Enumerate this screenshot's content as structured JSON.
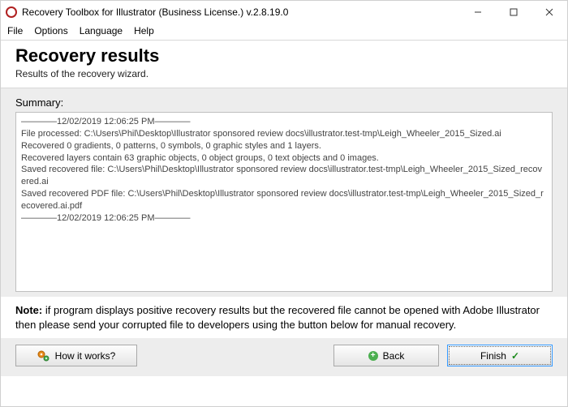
{
  "window": {
    "title": "Recovery Toolbox for Illustrator (Business License.) v.2.8.19.0"
  },
  "menu": {
    "file": "File",
    "options": "Options",
    "language": "Language",
    "help": "Help"
  },
  "heading": {
    "title": "Recovery results",
    "subtitle": "Results of the recovery wizard."
  },
  "summary": {
    "label": "Summary:",
    "text": "————12/02/2019 12:06:25 PM————\nFile processed: C:\\Users\\Phil\\Desktop\\Illustrator sponsored review docs\\illustrator.test-tmp\\Leigh_Wheeler_2015_Sized.ai\nRecovered 0 gradients, 0 patterns, 0 symbols, 0 graphic styles and 1 layers.\nRecovered layers contain 63 graphic objects, 0 object groups, 0 text objects and 0 images.\nSaved recovered file: C:\\Users\\Phil\\Desktop\\Illustrator sponsored review docs\\illustrator.test-tmp\\Leigh_Wheeler_2015_Sized_recovered.ai\nSaved recovered PDF file: C:\\Users\\Phil\\Desktop\\Illustrator sponsored review docs\\illustrator.test-tmp\\Leigh_Wheeler_2015_Sized_recovered.ai.pdf\n————12/02/2019 12:06:25 PM————"
  },
  "note": {
    "prefix": "Note:",
    "text": " if program displays positive recovery results but the recovered file cannot be opened with Adobe Illustrator then please send your corrupted file to developers using the button below for manual recovery."
  },
  "buttons": {
    "how": "How it works?",
    "back": "Back",
    "finish": "Finish"
  }
}
